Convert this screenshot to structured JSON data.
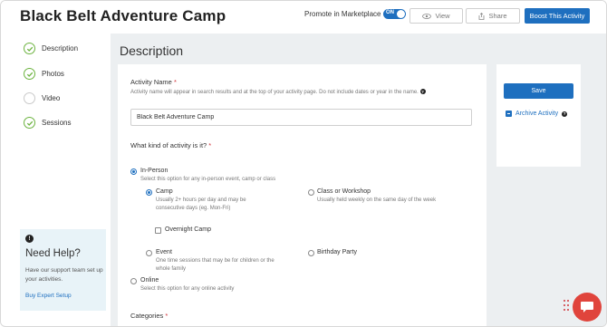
{
  "header": {
    "title": "Black Belt Adventure Camp",
    "promote_label": "Promote in Marketplace",
    "toggle_label": "ON",
    "view_label": "View",
    "share_label": "Share",
    "boost_label": "Boost This Activity"
  },
  "sidebar": {
    "items": [
      {
        "label": "Description",
        "complete": true
      },
      {
        "label": "Photos",
        "complete": true
      },
      {
        "label": "Video",
        "complete": false
      },
      {
        "label": "Sessions",
        "complete": true
      }
    ]
  },
  "help": {
    "icon": "!",
    "title": "Need Help?",
    "text": "Have our support team set up your activities.",
    "link": "Buy Expert Setup"
  },
  "main": {
    "section_title": "Description",
    "activity_name": {
      "label": "Activity Name",
      "required_mark": "*",
      "hint": "Activity name will appear in search results and at the top of your activity page. Do not include dates or year in the name.",
      "value": "Black Belt Adventure Camp"
    },
    "kind": {
      "label": "What kind of activity is it?",
      "required_mark": "*",
      "in_person": {
        "label": "In-Person",
        "desc": "Select this option for any in-person event, camp or class",
        "selected": true
      },
      "camp": {
        "label": "Camp",
        "desc": "Usually 2+ hours per day and may be consecutive days (eg. Mon-Fri)",
        "selected": true
      },
      "overnight": {
        "label": "Overnight Camp",
        "checked": false
      },
      "class_workshop": {
        "label": "Class or Workshop",
        "desc": "Usually held weekly on the same day of the week",
        "selected": false
      },
      "event": {
        "label": "Event",
        "desc": "One time sessions that may be for children or the whole family",
        "selected": false
      },
      "birthday": {
        "label": "Birthday Party",
        "selected": false
      },
      "online": {
        "label": "Online",
        "desc": "Select this option for any online activity",
        "selected": false
      }
    },
    "categories": {
      "label": "Categories",
      "required_mark": "*"
    }
  },
  "actions": {
    "save_label": "Save",
    "archive_label": "Archive Activity",
    "archive_help": "?"
  },
  "colors": {
    "accent": "#1e6fbf",
    "success": "#6cb33f",
    "required": "#d0343a",
    "chat": "#e0443c"
  }
}
